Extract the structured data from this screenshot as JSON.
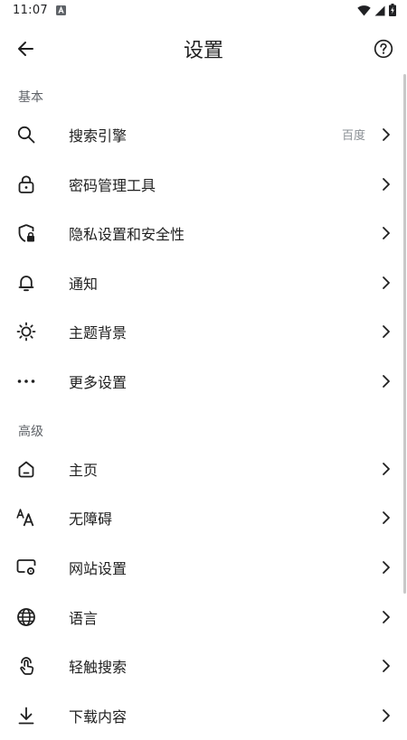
{
  "status_bar": {
    "time": "11:07"
  },
  "app_bar": {
    "title": "设置"
  },
  "sections": {
    "basic": {
      "header": "基本",
      "items": [
        {
          "label": "搜索引擎",
          "value": "百度"
        },
        {
          "label": "密码管理工具"
        },
        {
          "label": "隐私设置和安全性"
        },
        {
          "label": "通知"
        },
        {
          "label": "主题背景"
        },
        {
          "label": "更多设置"
        }
      ]
    },
    "advanced": {
      "header": "高级",
      "items": [
        {
          "label": "主页"
        },
        {
          "label": "无障碍"
        },
        {
          "label": "网站设置"
        },
        {
          "label": "语言"
        },
        {
          "label": "轻触搜索"
        },
        {
          "label": "下载内容"
        }
      ]
    }
  },
  "icons": {
    "back": "back-arrow-icon",
    "help": "help-icon",
    "search_engine": "search-icon",
    "password": "lock-icon",
    "privacy": "shield-lock-icon",
    "notifications": "bell-icon",
    "theme": "brightness-icon",
    "more": "more-horiz-icon",
    "homepage": "home-icon",
    "accessibility": "text-size-icon",
    "site_settings": "site-settings-icon",
    "languages": "globe-icon",
    "touch_search": "touch-icon",
    "downloads": "download-icon"
  },
  "colors": {
    "text": "#1f1f1f",
    "secondary": "#5f6368",
    "background": "#ffffff"
  }
}
